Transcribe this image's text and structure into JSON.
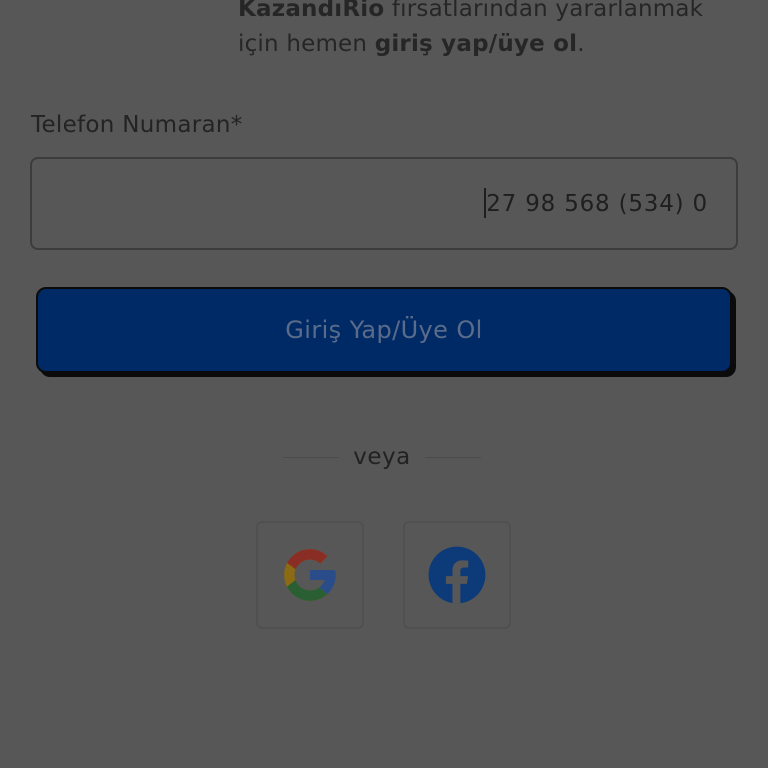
{
  "intro": {
    "line1_brand": "KazandıRio",
    "line1_rest": " fırsatlarından yararlanmak",
    "line2_start": "için hemen ",
    "line2_bold": "giriş yap/üye ol",
    "line2_end": "."
  },
  "form": {
    "phone_label": "Telefon Numaran*",
    "phone_value": "27 98 568 (534) 0"
  },
  "submit": {
    "label": "Giriş Yap/Üye Ol"
  },
  "divider": {
    "text": "veya"
  },
  "social": {
    "google_icon": "google-icon",
    "facebook_icon": "facebook-icon"
  },
  "colors": {
    "overlay": "#575757",
    "primary_button": "#002a66",
    "google_blue": "#2a4d8a",
    "google_red": "#8a2d24",
    "google_yellow": "#8a6a12",
    "google_green": "#2a5e33",
    "facebook_blue": "#0d3a78"
  }
}
